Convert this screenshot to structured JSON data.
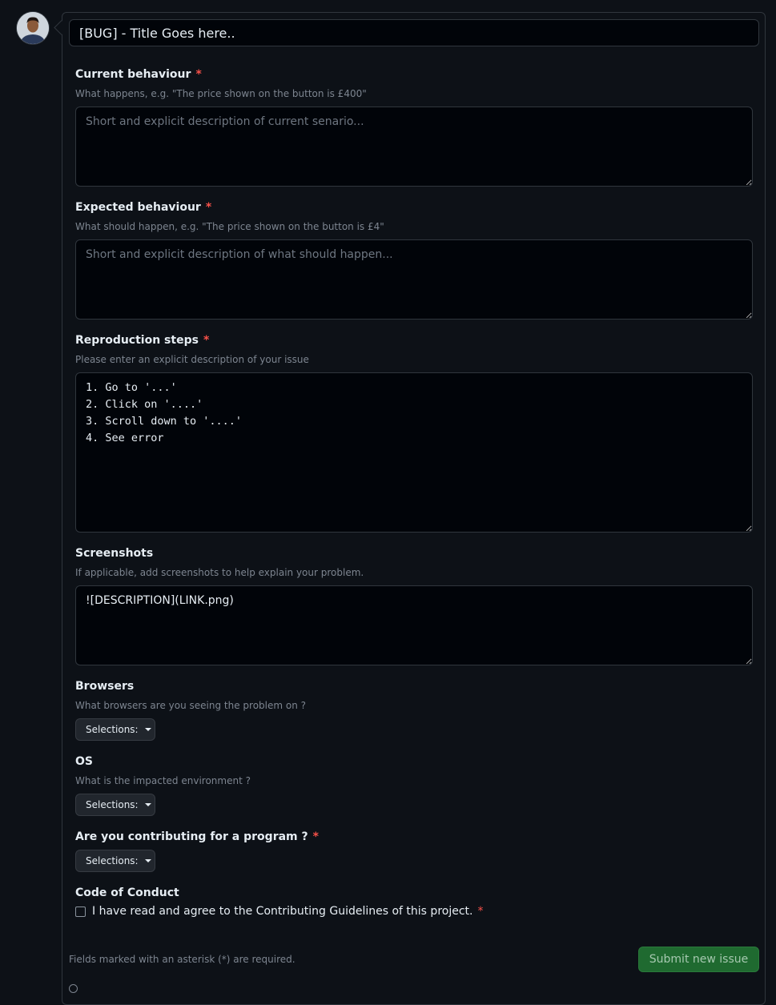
{
  "issue": {
    "title_value": "[BUG] - Title Goes here.."
  },
  "fields": {
    "current": {
      "label": "Current behaviour",
      "required_mark": "*",
      "description": "What happens, e.g. \"The price shown on the button is £400\"",
      "placeholder": "Short and explicit description of current senario..."
    },
    "expected": {
      "label": "Expected behaviour",
      "required_mark": "*",
      "description": "What should happen, e.g. \"The price shown on the button is £4\"",
      "placeholder": "Short and explicit description of what should happen..."
    },
    "steps": {
      "label": "Reproduction steps",
      "required_mark": "*",
      "description": "Please enter an explicit description of your issue",
      "value": "1. Go to '...'\n2. Click on '....'\n3. Scroll down to '....'\n4. See error"
    },
    "screenshots": {
      "label": "Screenshots",
      "description": "If applicable, add screenshots to help explain your problem.",
      "value": "![DESCRIPTION](LINK.png)"
    },
    "browsers": {
      "label": "Browsers",
      "description": "What browsers are you seeing the problem on ?",
      "select_label": "Selections:"
    },
    "os": {
      "label": "OS",
      "description": "What is the impacted environment ?",
      "select_label": "Selections:"
    },
    "program": {
      "label": "Are you contributing for a program ?",
      "required_mark": "*",
      "select_label": "Selections:"
    },
    "coc": {
      "label": "Code of Conduct",
      "checkbox_label": "I have read and agree to the Contributing Guidelines of this project.",
      "required_mark": "*"
    }
  },
  "footer": {
    "note": "Fields marked with an asterisk (*) are required.",
    "submit_label": "Submit new issue"
  },
  "colors": {
    "background": "#0d1117",
    "required": "#f85149",
    "submit": "#1f6a30"
  }
}
